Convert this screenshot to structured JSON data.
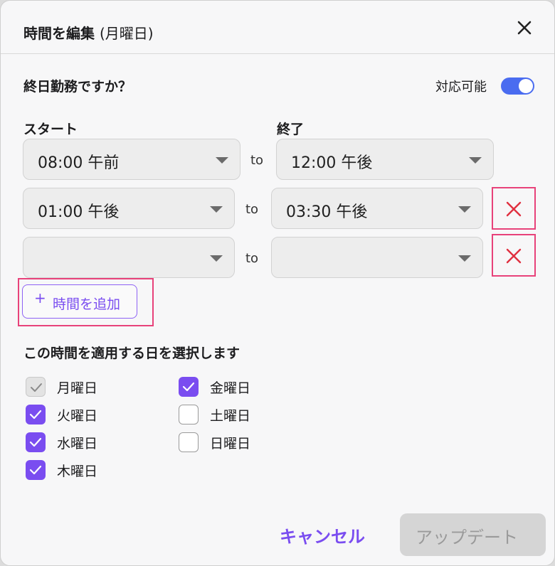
{
  "dialog": {
    "title": "時間を編集",
    "title_day": "(月曜日)",
    "close_icon": "close-icon"
  },
  "allday": {
    "question": "終日勤務ですか？",
    "toggle_label": "対応可能",
    "toggle_on": true
  },
  "columns": {
    "start": "スタート",
    "end": "終了"
  },
  "rows": [
    {
      "start": "08:00 午前",
      "to": "to",
      "end": "12:00 午後",
      "removable": false
    },
    {
      "start": "01:00 午後",
      "to": "to",
      "end": "03:30 午後",
      "removable": true
    },
    {
      "start": "",
      "to": "to",
      "end": "",
      "removable": true
    }
  ],
  "add_time_label": "時間を追加",
  "days_title": "この時間を適用する日を選択します",
  "days": [
    {
      "label": "月曜日",
      "state": "disabled-checked"
    },
    {
      "label": "火曜日",
      "state": "checked"
    },
    {
      "label": "水曜日",
      "state": "checked"
    },
    {
      "label": "木曜日",
      "state": "checked"
    },
    {
      "label": "金曜日",
      "state": "checked"
    },
    {
      "label": "土曜日",
      "state": "unchecked"
    },
    {
      "label": "日曜日",
      "state": "unchecked"
    }
  ],
  "footer": {
    "cancel": "キャンセル",
    "update": "アップデート"
  },
  "colors": {
    "accent": "#7a4df0",
    "toggle": "#4a6cf0",
    "remove": "#e03040",
    "highlight": "#e8427a"
  }
}
